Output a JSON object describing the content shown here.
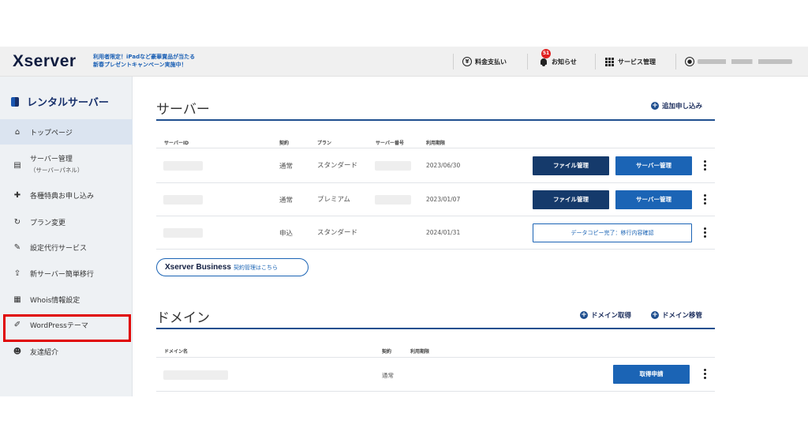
{
  "header": {
    "logo": "Xserver",
    "campaign_line1": "利用者限定！iPadなど豪華賞品が当たる",
    "campaign_line2": "新春プレゼントキャンペーン実施中！",
    "payment_label": "料金支払い",
    "notifications_label": "お知らせ",
    "notifications_badge": "51",
    "service_mgmt_label": "サービス管理"
  },
  "sidebar": {
    "title": "レンタルサーバー",
    "items": [
      {
        "label": "トップページ"
      },
      {
        "label": "サーバー管理",
        "sub": "（サーバーパネル）"
      },
      {
        "label": "各種特典お申し込み"
      },
      {
        "label": "プラン変更"
      },
      {
        "label": "設定代行サービス"
      },
      {
        "label": "新サーバー簡単移行"
      },
      {
        "label": "Whois情報設定"
      },
      {
        "label": "WordPressテーマ"
      },
      {
        "label": "友達紹介"
      }
    ]
  },
  "server_section": {
    "title": "サーバー",
    "add_link": "追加申し込み",
    "columns": [
      "サーバーID",
      "契約",
      "プラン",
      "サーバー番号",
      "利用期限"
    ],
    "rows": [
      {
        "contract": "通常",
        "plan": "スタンダード",
        "expiry": "2023/06/30",
        "btn1": "ファイル管理",
        "btn2": "サーバー管理"
      },
      {
        "contract": "通常",
        "plan": "プレミアム",
        "expiry": "2023/01/07",
        "btn1": "ファイル管理",
        "btn2": "サーバー管理"
      },
      {
        "contract": "申込",
        "plan": "スタンダード",
        "expiry": "2024/01/31",
        "btn_outline": "データコピー完了：移行内容確認"
      }
    ]
  },
  "business_pill": {
    "brand": "Xserver Business",
    "text": "契約管理はこちら"
  },
  "domain_section": {
    "title": "ドメイン",
    "link1": "ドメイン取得",
    "link2": "ドメイン移管",
    "columns": [
      "ドメイン名",
      "契約",
      "利用期限"
    ],
    "rows": [
      {
        "contract": "通常",
        "btn": "取得申請"
      }
    ]
  },
  "colors": {
    "accent": "#1b64b5",
    "navy": "#153a6b",
    "highlight_box": "#e00000"
  }
}
